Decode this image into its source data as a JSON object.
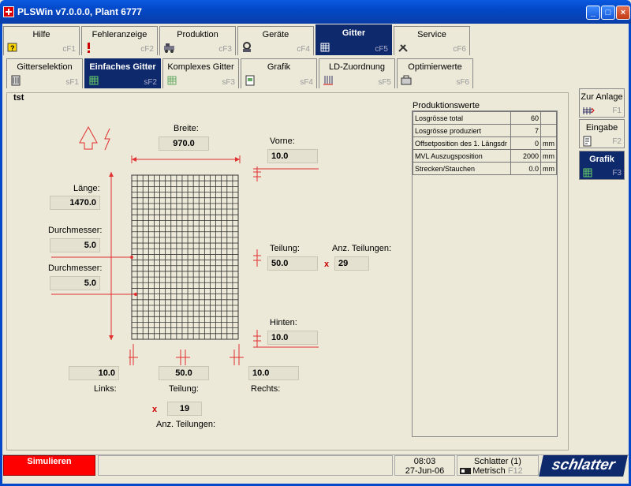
{
  "window": {
    "title": "PLSWin v7.0.0.0,  Plant 6777"
  },
  "tabs_row1": [
    {
      "label": "Hilfe",
      "key": "cF1"
    },
    {
      "label": "Fehleranzeige",
      "key": "cF2"
    },
    {
      "label": "Produktion",
      "key": "cF3"
    },
    {
      "label": "Geräte",
      "key": "cF4"
    },
    {
      "label": "Gitter",
      "key": "cF5"
    },
    {
      "label": "Service",
      "key": "cF6"
    }
  ],
  "tabs_row2": [
    {
      "label": "Gitterselektion",
      "key": "sF1"
    },
    {
      "label": "Einfaches Gitter",
      "key": "sF2"
    },
    {
      "label": "Komplexes Gitter",
      "key": "sF3"
    },
    {
      "label": "Grafik",
      "key": "sF4"
    },
    {
      "label": "LD-Zuordnung",
      "key": "sF5"
    },
    {
      "label": "Optimierwerte",
      "key": "sF6"
    }
  ],
  "panel": {
    "title": "tst"
  },
  "fields": {
    "breite_label": "Breite:",
    "breite": "970.0",
    "vorne_label": "Vorne:",
    "vorne": "10.0",
    "laenge_label": "Länge:",
    "laenge": "1470.0",
    "durchmesser1_label": "Durchmesser:",
    "durchmesser1": "5.0",
    "durchmesser2_label": "Durchmesser:",
    "durchmesser2": "5.0",
    "teilung_r_label": "Teilung:",
    "teilung_r": "50.0",
    "anz_teil_r_label": "Anz. Teilungen:",
    "anz_teil_r": "29",
    "hinten_label": "Hinten:",
    "hinten": "10.0",
    "links": "10.0",
    "links_label": "Links:",
    "teilung_b": "50.0",
    "teilung_b_label": "Teilung:",
    "rechts": "10.0",
    "rechts_label": "Rechts:",
    "anz_teil_b": "19",
    "anz_teil_b_label": "Anz. Teilungen:",
    "x_mark": "x"
  },
  "produktionswerte": {
    "title": "Produktionswerte",
    "rows": [
      {
        "label": "Losgrösse total",
        "value": "60",
        "unit": ""
      },
      {
        "label": "Losgrösse produziert",
        "value": "7",
        "unit": ""
      },
      {
        "label": "Offsetposition des 1. Längsdr",
        "value": "0",
        "unit": "mm"
      },
      {
        "label": "MVL Auszugsposition",
        "value": "2000",
        "unit": "mm"
      },
      {
        "label": "Strecken/Stauchen",
        "value": "0.0",
        "unit": "mm"
      }
    ]
  },
  "sidebar": [
    {
      "label": "Zur Anlage",
      "key": "F1"
    },
    {
      "label": "Eingabe",
      "key": "F2"
    },
    {
      "label": "Grafik",
      "key": "F3"
    }
  ],
  "status": {
    "simulate": "Simulieren",
    "time": "08:03",
    "date": "27-Jun-06",
    "user": "Schlatter (1)",
    "units": "Metrisch",
    "units_key": "F12",
    "logo": "schlatter"
  },
  "colors": {
    "accent": "#0e2a6c",
    "red": "#e03030",
    "sim": "#ff0000"
  }
}
